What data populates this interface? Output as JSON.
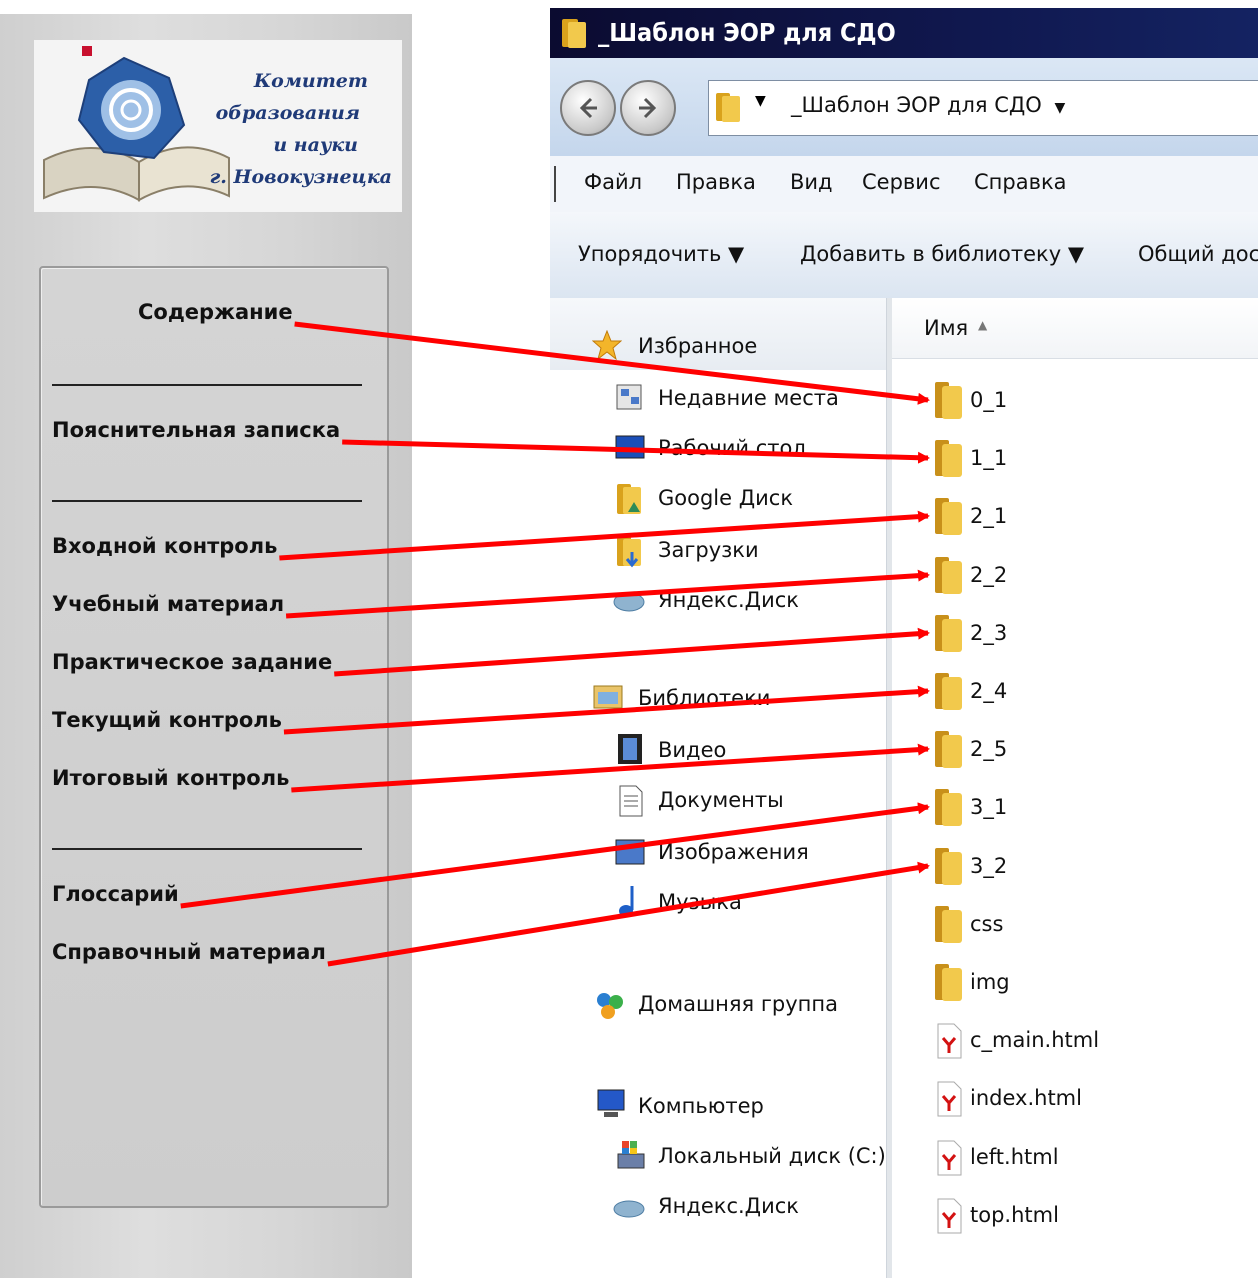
{
  "logo": {
    "lines": [
      "Комитет",
      "образования",
      "и науки",
      "г. Новокузнецка"
    ]
  },
  "left_menu": {
    "items": [
      {
        "label": "Содержание",
        "target_folder": "0_1"
      },
      {
        "label": "Пояснительная записка",
        "target_folder": "1_1"
      },
      {
        "label": "Входной контроль",
        "target_folder": "2_1"
      },
      {
        "label": "Учебный материал",
        "target_folder": "2_2"
      },
      {
        "label": "Практическое задание",
        "target_folder": "2_3"
      },
      {
        "label": "Текущий контроль",
        "target_folder": "2_4"
      },
      {
        "label": "Итоговый контроль",
        "target_folder": "2_5"
      },
      {
        "label": "Глоссарий",
        "target_folder": "3_1"
      },
      {
        "label": "Справочный материал",
        "target_folder": "3_2"
      }
    ]
  },
  "explorer": {
    "title": "_Шаблон ЭОР для СДО",
    "address": "_Шаблон ЭОР для СДО",
    "menu": [
      "Файл",
      "Правка",
      "Вид",
      "Сервис",
      "Справка"
    ],
    "toolbar": [
      "Упорядочить ▼",
      "Добавить в библиотеку ▼",
      "Общий дос"
    ],
    "column_header": "Имя",
    "nav": {
      "favorites": {
        "label": "Избранное",
        "items": [
          "Недавние места",
          "Рабочий стол",
          "Google Диск",
          "Загрузки",
          "Яндекс.Диск"
        ]
      },
      "libraries": {
        "label": "Библиотеки",
        "items": [
          "Видео",
          "Документы",
          "Изображения",
          "Музыка"
        ]
      },
      "homegroup": "Домашняя группа",
      "computer": {
        "label": "Компьютер",
        "items": [
          "Локальный диск (C:)",
          "Яндекс.Диск"
        ]
      }
    },
    "files": [
      {
        "name": "0_1",
        "type": "folder"
      },
      {
        "name": "1_1",
        "type": "folder"
      },
      {
        "name": "2_1",
        "type": "folder"
      },
      {
        "name": "2_2",
        "type": "folder"
      },
      {
        "name": "2_3",
        "type": "folder"
      },
      {
        "name": "2_4",
        "type": "folder"
      },
      {
        "name": "2_5",
        "type": "folder"
      },
      {
        "name": "3_1",
        "type": "folder"
      },
      {
        "name": "3_2",
        "type": "folder"
      },
      {
        "name": "css",
        "type": "folder"
      },
      {
        "name": "img",
        "type": "folder"
      },
      {
        "name": "c_main.html",
        "type": "html"
      },
      {
        "name": "index.html",
        "type": "html"
      },
      {
        "name": "left.html",
        "type": "html"
      },
      {
        "name": "top.html",
        "type": "html"
      }
    ]
  },
  "colors": {
    "arrow": "#ff0000",
    "title_bar": "#10184f",
    "folder": "#e8b82a",
    "logo_text": "#1f3a78"
  }
}
